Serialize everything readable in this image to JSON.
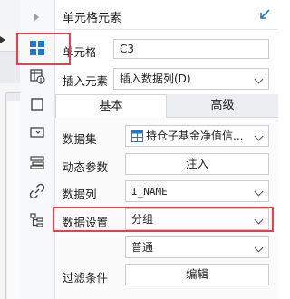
{
  "panel": {
    "title": "单元格元素"
  },
  "cell": {
    "label": "单元格",
    "value": "C3"
  },
  "insert": {
    "label": "插入元素",
    "value": "插入数据列(D)"
  },
  "tabs": [
    {
      "label": "基本"
    },
    {
      "label": "高级"
    }
  ],
  "dataset": {
    "label": "数据集",
    "value": "持仓子基金净值信..."
  },
  "dynamic_params": {
    "label": "动态参数",
    "button": "注入"
  },
  "data_column": {
    "label": "数据列",
    "value": "I_NAME"
  },
  "data_setting": {
    "label": "数据设置",
    "value": "分组"
  },
  "group_mode": {
    "value": "普通"
  },
  "filter": {
    "label": "过滤条件",
    "button": "编辑"
  },
  "icons": [
    "collapse-arrow-icon",
    "cell-element-icon",
    "cell-attribute-icon",
    "border-icon",
    "widget-icon",
    "condition-icon",
    "hyperlink-icon",
    "tree-icon"
  ],
  "colors": {
    "accent": "#1f77d2",
    "highlight": "#e2424f"
  }
}
